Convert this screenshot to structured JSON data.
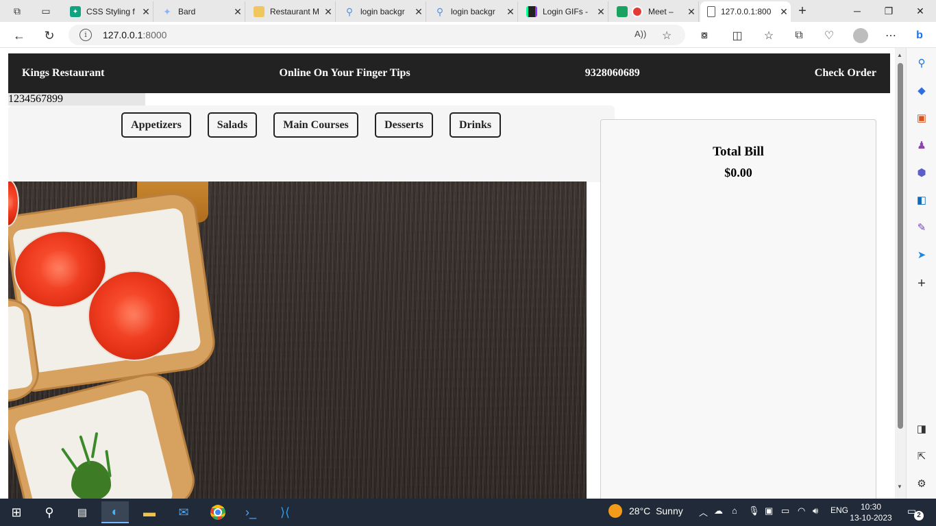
{
  "browser": {
    "tabs": [
      {
        "title": "CSS Styling f",
        "icon": "chatgpt-icon",
        "color": "#10a37f"
      },
      {
        "title": "Bard",
        "icon": "bard-icon",
        "color": "#8ab4f8"
      },
      {
        "title": "Restaurant M",
        "icon": "folder-icon",
        "color": "#f0c75e"
      },
      {
        "title": "login backgr",
        "icon": "search-icon",
        "color": "#5f8fd6"
      },
      {
        "title": "login backgr",
        "icon": "search-icon",
        "color": "#5f8fd6"
      },
      {
        "title": "Login GIFs -",
        "icon": "giphy-icon",
        "color": "#222222"
      },
      {
        "title": "Meet –",
        "icon": "meet-icon",
        "color": "#e53935"
      },
      {
        "title": "127.0.0.1:800",
        "icon": "page-icon",
        "color": "#555555"
      }
    ],
    "url_host": "127.0.0.1",
    "url_port": ":8000"
  },
  "site": {
    "brand": "Kings Restaurant",
    "tagline": "Online On Your Finger Tips",
    "phone": "9328060689",
    "check_order": "Check Order",
    "strip_number": "1234567899"
  },
  "categories": [
    "Appetizers",
    "Salads",
    "Main Courses",
    "Desserts",
    "Drinks"
  ],
  "bill": {
    "title": "Total Bill",
    "amount": "$0.00"
  },
  "taskbar": {
    "temperature": "28°C",
    "condition": "Sunny",
    "lang": "ENG",
    "time": "10:30",
    "date": "13-10-2023",
    "notifications": "2"
  }
}
